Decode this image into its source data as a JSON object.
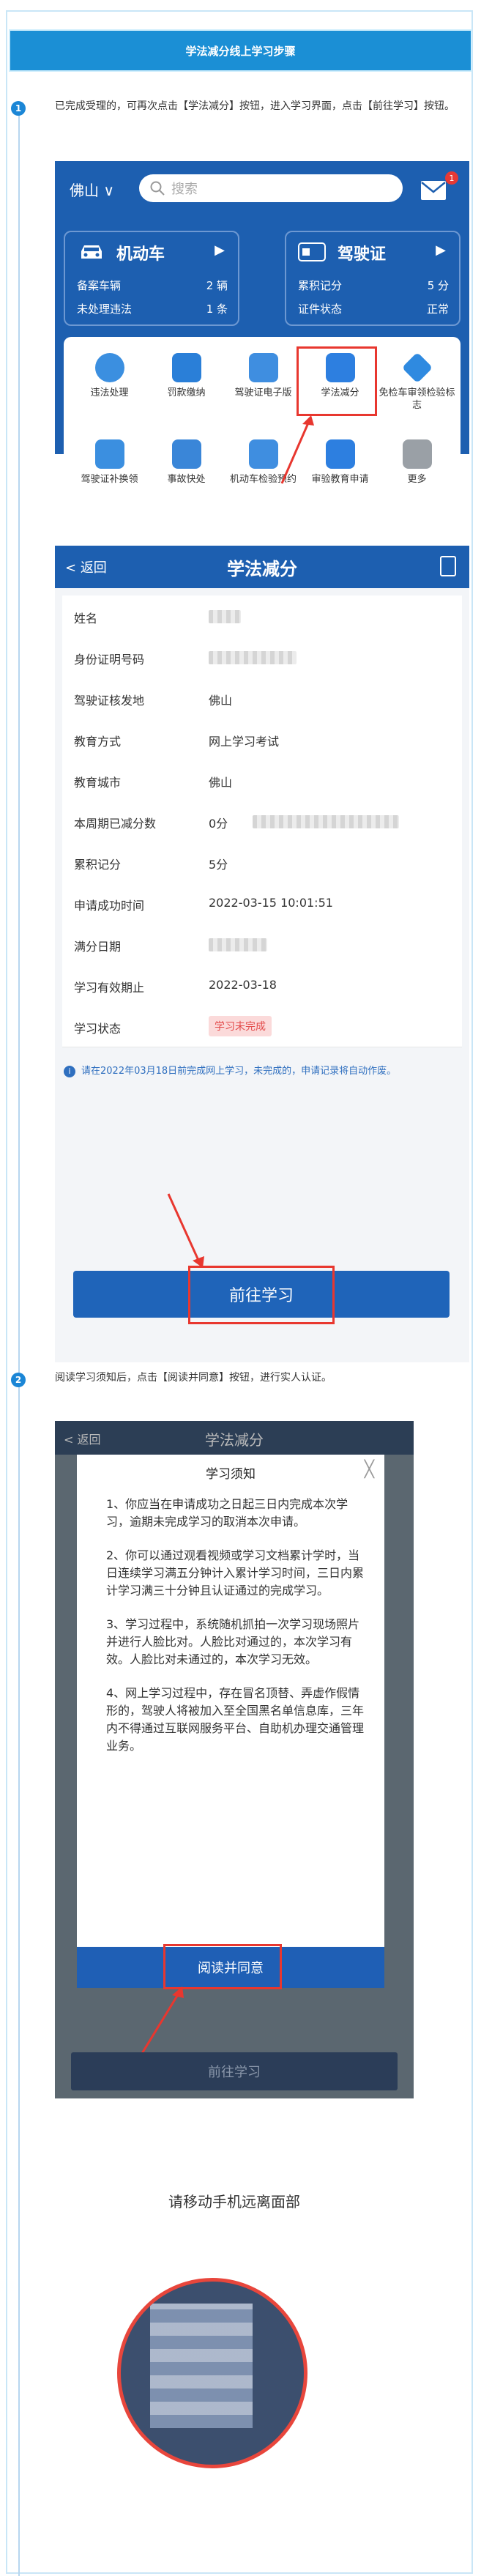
{
  "header": {
    "title": "学法减分线上学习步骤"
  },
  "step1": {
    "number": "1",
    "text": "已完成受理的，可再次点击【学法减分】按钮，进入学习界面，点击【前往学习】按钮。"
  },
  "home": {
    "city": "佛山 ∨",
    "search_placeholder": "搜索",
    "mail_badge": "1",
    "vehicle_card": {
      "title": "机动车",
      "arrow": "▶",
      "rows": [
        {
          "label": "备案车辆",
          "value": "2 辆"
        },
        {
          "label": "未处理违法",
          "value": "1 条"
        }
      ]
    },
    "license_card": {
      "title": "驾驶证",
      "arrow": "▶",
      "rows": [
        {
          "label": "累积记分",
          "value": "5 分"
        },
        {
          "label": "证件状态",
          "value": "正常"
        }
      ]
    },
    "menu": [
      {
        "label": "违法处理",
        "icon": "violation-icon",
        "color": "#3b8fe0"
      },
      {
        "label": "罚款缴纳",
        "icon": "fine-payment-icon",
        "color": "#2a7fd8"
      },
      {
        "label": "驾驶证电子版",
        "icon": "e-license-icon",
        "color": "#3f8ee0"
      },
      {
        "label": "学法减分",
        "icon": "study-book-icon",
        "color": "#2d7fe0"
      },
      {
        "label": "免检车审领检验标志",
        "icon": "exempt-inspection-icon",
        "color": "#2f8ae0"
      },
      {
        "label": "驾驶证补换领",
        "icon": "license-replace-icon",
        "color": "#3b8fe0"
      },
      {
        "label": "事故快处",
        "icon": "accident-icon",
        "color": "#3a86d8"
      },
      {
        "label": "机动车检验预约",
        "icon": "inspection-booking-icon",
        "color": "#3f8ee0"
      },
      {
        "label": "审验教育申请",
        "icon": "review-education-icon",
        "color": "#2d7fe0"
      },
      {
        "label": "更多",
        "icon": "more-grid-icon",
        "color": "#9aa0a6"
      }
    ]
  },
  "detail": {
    "back": "返回",
    "title": "学法减分",
    "rows": [
      {
        "k": "姓名",
        "v": ""
      },
      {
        "k": "身份证明号码",
        "v": ""
      },
      {
        "k": "驾驶证核发地",
        "v": "佛山"
      },
      {
        "k": "教育方式",
        "v": "网上学习考试"
      },
      {
        "k": "教育城市",
        "v": "佛山"
      },
      {
        "k": "本周期已减分数",
        "v": "0分"
      },
      {
        "k": "累积记分",
        "v": "5分"
      },
      {
        "k": "申请成功时间",
        "v": "2022-03-15 10:01:51"
      },
      {
        "k": "满分日期",
        "v": ""
      },
      {
        "k": "学习有效期止",
        "v": "2022-03-18"
      },
      {
        "k": "学习状态",
        "v": "学习未完成"
      }
    ],
    "notice": "请在2022年03月18日前完成网上学习，未完成的，申请记录将自动作废。",
    "button": "前往学习"
  },
  "step2": {
    "number": "2",
    "text": "阅读学习须知后，点击【阅读并同意】按钮，进行实人认证。"
  },
  "modal": {
    "nav_back": "返回",
    "nav_title": "学法减分",
    "title": "学习须知",
    "close": "╳",
    "paragraphs": [
      "1、你应当在申请成功之日起三日内完成本次学习，逾期未完成学习的取消本次申请。",
      "2、你可以通过观看视频或学习文档累计学时，当日连续学习满五分钟计入累计学习时间，三日内累计学习满三十分钟且认证通过的完成学习。",
      "3、学习过程中，系统随机抓拍一次学习现场照片并进行人脸比对。人脸比对通过的，本次学习有效。人脸比对未通过的，本次学习无效。",
      "4、网上学习过程中，存在冒名顶替、弄虚作假情形的，驾驶人将被加入至全国黑名单信息库，三年内不得通过互联网服务平台、自助机办理交通管理业务。"
    ],
    "agree_button": "阅读并同意",
    "bg_button": "前往学习"
  },
  "face": {
    "title": "请移动手机远离面部"
  }
}
